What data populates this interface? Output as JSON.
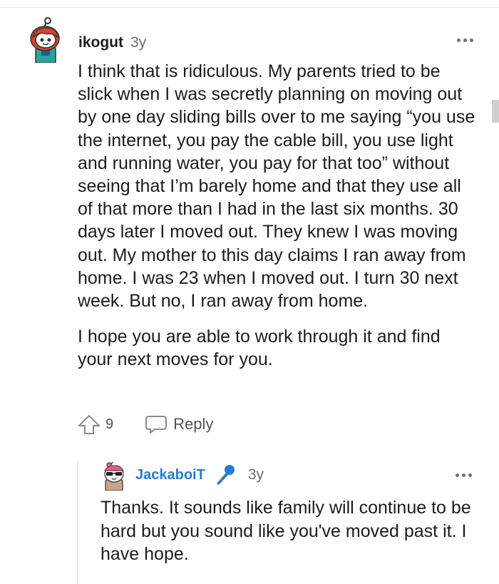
{
  "comment": {
    "username": "ikogut",
    "timestamp": "3y",
    "body": [
      "I think that is ridiculous. My parents tried to be slick when I was secretly planning on moving out by one day sliding bills over to me saying “you use the internet, you pay the cable bill, you use light and running water, you pay for that too” without seeing that I’m barely home and that they use all of that more than I had in the last six months. 30 days later I moved out. They knew I was moving out. My mother to this day claims I ran away from home. I was 23 when I moved out. I turn 30 next week. But no, I ran away from home.",
      "I hope you are able to work through it and find your next moves for you."
    ],
    "vote_count": "9",
    "reply_label": "Reply",
    "avatar_icon": "snoo-avatar-red-hair",
    "upvote_icon": "upvote-arrow-icon",
    "reply_icon": "speech-bubble-icon",
    "more_icon": "more-options-icon"
  },
  "reply": {
    "username": "JackaboiT",
    "timestamp": "3y",
    "body": "Thanks. It sounds like family will continue to be hard but you sound like you've moved past it. I have hope.",
    "flair_icon": "microphone-icon",
    "avatar_icon": "snoo-avatar-sunglasses",
    "username_color": "#2a7bd1"
  }
}
